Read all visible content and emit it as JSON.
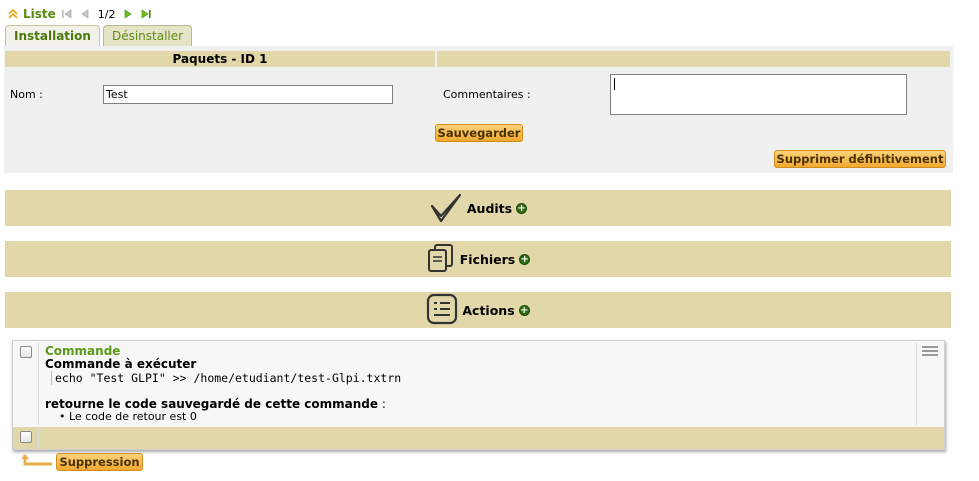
{
  "nav": {
    "liste_label": "Liste",
    "pager": "1/2"
  },
  "tabs": [
    {
      "label": "Installation",
      "active": true
    },
    {
      "label": "Désinstaller",
      "active": false
    }
  ],
  "form": {
    "header_title": "Paquets - ID 1",
    "nom_label": "Nom :",
    "nom_value": "Test",
    "commentaires_label": "Commentaires :",
    "save_label": "Sauvegarder",
    "delete_label": "Supprimer définitivement"
  },
  "sections": {
    "audits": "Audits",
    "fichiers": "Fichiers",
    "actions": "Actions"
  },
  "action": {
    "title": "Commande",
    "subtitle": "Commande à exécuter",
    "command": "echo \"Test GLPI\" >> /home/etudiant/test-Glpi.txtrn",
    "return_bold": "retourne le code sauvegardé de cette commande",
    "return_suffix": " :",
    "return_item": "Le code de retour est 0"
  },
  "bulk": {
    "suppression_label": "Suppression"
  },
  "colors": {
    "accent_green": "#5a9a16",
    "section_bg": "#e2d7a9",
    "button_orange": "#f6b646"
  }
}
